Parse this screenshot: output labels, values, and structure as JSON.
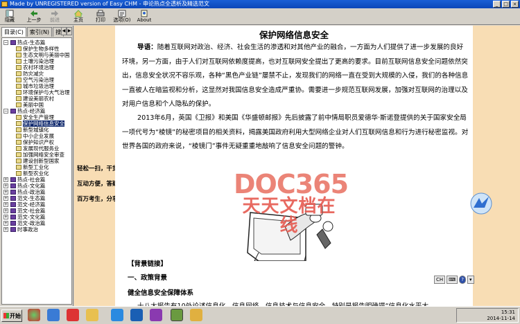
{
  "window": {
    "title": "Made by UNREGISTERED version of Easy CHM - 申论热点全透析及精选范文"
  },
  "toolbar": {
    "buttons": [
      {
        "label": "隐藏",
        "icon": "hide-icon"
      },
      {
        "label": "上一步",
        "icon": "back-arrow-icon"
      },
      {
        "label": "前进",
        "icon": "forward-arrow-icon"
      },
      {
        "label": "主页",
        "icon": "home-icon"
      },
      {
        "label": "打印",
        "icon": "print-icon"
      },
      {
        "label": "选项(O)",
        "icon": "options-icon"
      },
      {
        "label": "About",
        "icon": "about-icon"
      }
    ]
  },
  "nav": {
    "tabs": [
      "目录(C)",
      "索引(N)",
      "搜"
    ],
    "tree": [
      {
        "label": "热点-生态篇",
        "level": 0,
        "type": "folder-open"
      },
      {
        "label": "保护生物多样性",
        "level": 1,
        "type": "page"
      },
      {
        "label": "生态文明与美丽中国",
        "level": 1,
        "type": "page"
      },
      {
        "label": "土壤污染治理",
        "level": 1,
        "type": "page"
      },
      {
        "label": "农村环境治理",
        "level": 1,
        "type": "page"
      },
      {
        "label": "防灾减灾",
        "level": 1,
        "type": "page"
      },
      {
        "label": "空气污染治理",
        "level": 1,
        "type": "page"
      },
      {
        "label": "城市垃圾治理",
        "level": 1,
        "type": "page"
      },
      {
        "label": "环境保护与大气治理",
        "level": 1,
        "type": "page"
      },
      {
        "label": "建设美丽农村",
        "level": 1,
        "type": "page"
      },
      {
        "label": "美丽中国",
        "level": 1,
        "type": "page"
      },
      {
        "label": "热点-经济篇",
        "level": 0,
        "type": "folder-open"
      },
      {
        "label": "安全生产管理",
        "level": 1,
        "type": "page"
      },
      {
        "label": "保护网络信息安全",
        "level": 1,
        "type": "page",
        "selected": true
      },
      {
        "label": "新型城镇化",
        "level": 1,
        "type": "page"
      },
      {
        "label": "中小企业发展",
        "level": 1,
        "type": "page"
      },
      {
        "label": "保护知识产权",
        "level": 1,
        "type": "page"
      },
      {
        "label": "发展现代服务业",
        "level": 1,
        "type": "page"
      },
      {
        "label": "加强网络安全审查",
        "level": 1,
        "type": "page"
      },
      {
        "label": "建设创新型国家",
        "level": 1,
        "type": "page"
      },
      {
        "label": "新型工业化",
        "level": 1,
        "type": "page"
      },
      {
        "label": "新型农业化",
        "level": 1,
        "type": "page"
      },
      {
        "label": "热点-社会篇",
        "level": 0,
        "type": "folder"
      },
      {
        "label": "热点-文化篇",
        "level": 0,
        "type": "folder"
      },
      {
        "label": "热点-政治篇",
        "level": 0,
        "type": "folder"
      },
      {
        "label": "范文-生态篇",
        "level": 0,
        "type": "folder"
      },
      {
        "label": "范文-经济篇",
        "level": 0,
        "type": "folder"
      },
      {
        "label": "范文-社会篇",
        "level": 0,
        "type": "folder"
      },
      {
        "label": "范文-文化篇",
        "level": 0,
        "type": "folder"
      },
      {
        "label": "范文-政治篇",
        "level": 0,
        "type": "folder"
      },
      {
        "label": "时事政治",
        "level": 0,
        "type": "folder"
      }
    ]
  },
  "document": {
    "title": "保护网络信息安全",
    "intro_label": "导语：",
    "intro_text": "随着互联网对政治、经济、社会生活的渗透和对其他产业的融合，一方面为人们提供了进一步发展的良好环境，另一方面，由于人们对互联网依赖度提高，也对互联网安全提出了更高的要求。目前互联网信息安全问题依然突出，信息安全状况不容乐观，各种“黑色产业链”屡禁不止，发现我们的网络一直在受到大规模的入侵，我们的各种信息一直被人在暗监视和分析，这显然对我国信息安全造成严重协。需要进一步规范互联网发展，加强对互联网的治理以及对用户信息和个人隐私的保护。",
    "para2": "2013年6月，英国《卫报》和美国《华盛顿邮报》先后披露了前中情局职员爱德华·斯诺登提供的关于国家安全局一项代号为“棱镜”的秘密项目的相关资料，揭露美国政府利用大型网络企业对人们互联网信息和行为进行秘密监视。对世界各国的政府来说，“棱镜门”事件无疑重重地敲响了信息安全问题的警钟。",
    "side_ads": [
      "轻松一扫，干货到手",
      "互动方便，答疑智能",
      "百万考生，分享经验"
    ],
    "section_link": "【背景链接】",
    "section1": "一、政策背景",
    "section1_sub": "健全信息安全保障体系",
    "last_line": "十八大报告有10处论述信息化、信息网络、信息技术与信息安全，特别是报告明确提“信息化水平大",
    "watermark_brand": "DOC365",
    "watermark_slogan": "天天文档在线"
  },
  "mini_toolbar": [
    "CH"
  ],
  "taskbar": {
    "start_label": "开始",
    "clock_time": "15:31",
    "clock_date": "2014-11-14"
  }
}
